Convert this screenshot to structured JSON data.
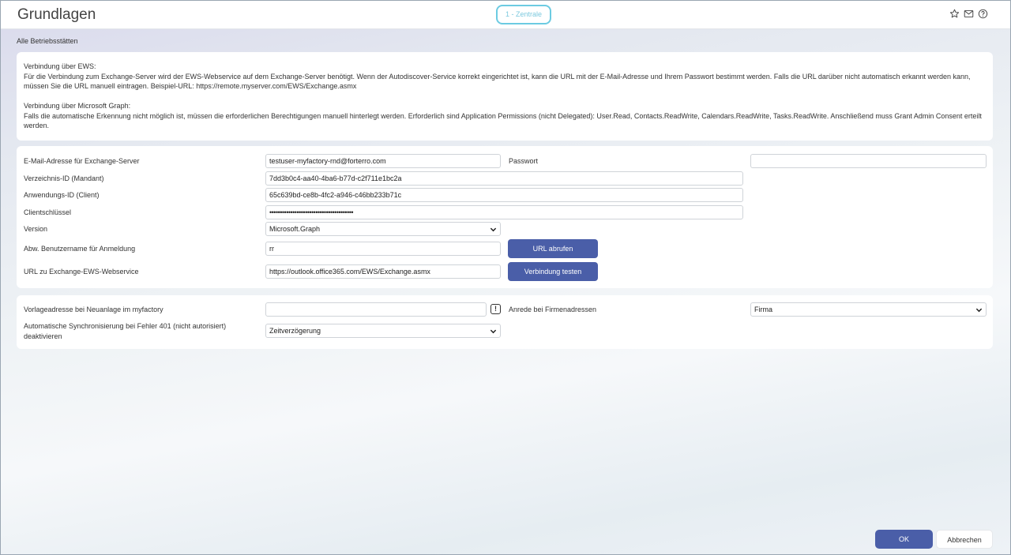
{
  "header": {
    "title": "Grundlagen",
    "company": "1 - Zentrale",
    "icons": [
      "star-icon",
      "mail-icon",
      "help-icon"
    ]
  },
  "subtitle": "Alle Betriebsstätten",
  "info": {
    "ews_heading": "Verbindung über EWS:",
    "ews_text": "Für die Verbindung zum Exchange-Server wird der EWS-Webservice auf dem Exchange-Server benötigt. Wenn der Autodiscover-Service korrekt eingerichtet ist, kann die URL mit der E-Mail-Adresse und Ihrem Passwort bestimmt werden. Falls die URL darüber nicht automatisch erkannt werden kann, müssen Sie die URL manuell eintragen. Beispiel-URL: https://remote.myserver.com/EWS/Exchange.asmx",
    "graph_heading": "Verbindung über Microsoft Graph:",
    "graph_text": "Falls die automatische Erkennung nicht möglich ist, müssen die erforderlichen Berechtigungen manuell hinterlegt werden. Erforderlich sind Application Permissions (nicht Delegated): User.Read, Contacts.ReadWrite, Calendars.ReadWrite, Tasks.ReadWrite. Anschließend muss Grant Admin Consent erteilt werden."
  },
  "form1": {
    "email_label": "E-Mail-Adresse für Exchange-Server",
    "email_value": "testuser-myfactory-rnd@forterro.com",
    "password_label": "Passwort",
    "password_value": "",
    "tenant_label": "Verzeichnis-ID (Mandant)",
    "tenant_value": "7dd3b0c4-aa40-4ba6-b77d-c2f711e1bc2a",
    "client_label": "Anwendungs-ID (Client)",
    "client_value": "65c639bd-ce8b-4fc2-a946-c46bb233b71c",
    "secret_label": "Clientschlüssel",
    "secret_value": "••••••••••••••••••••••••••••••••••••••••",
    "version_label": "Version",
    "version_value": "Microsoft.Graph",
    "altuser_label": "Abw. Benutzername für Anmeldung",
    "altuser_value": "rr",
    "fetch_url_button": "URL abrufen",
    "url_label": "URL zu Exchange-EWS-Webservice",
    "url_value": "https://outlook.office365.com/EWS/Exchange.asmx",
    "test_button": "Verbindung testen"
  },
  "form2": {
    "template_label": "Vorlageadresse bei Neuanlage im myfactory",
    "template_value": "",
    "salutation_label": "Anrede bei Firmenadressen",
    "salutation_value": "Firma",
    "sync_label_line1": "Automatische Synchronisierung bei Fehler 401 (nicht autorisiert)",
    "sync_label_line2": "deaktivieren",
    "sync_value": "Zeitverzögerung"
  },
  "footer": {
    "ok": "OK",
    "cancel": "Abbrechen"
  },
  "colors": {
    "primary_button": "#4a5ea8",
    "company_pill_border": "#6ccbe2"
  }
}
